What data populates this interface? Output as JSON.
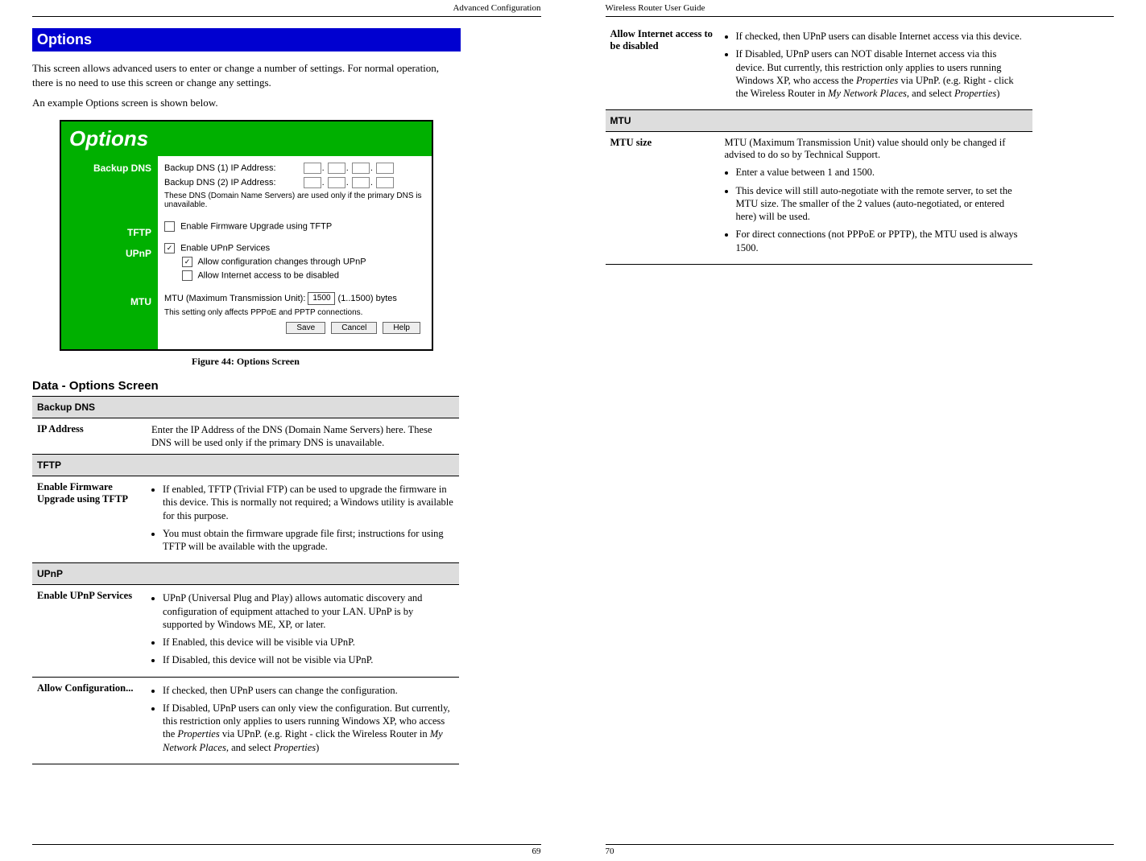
{
  "left": {
    "header": "Advanced Configuration",
    "section_title": "Options",
    "para1": "This screen allows advanced users to enter or change a number of settings. For normal operation, there is no need to use this screen or change any settings.",
    "para2": "An example Options screen is shown below.",
    "fig_caption": "Figure 44: Options Screen",
    "data_heading": "Data - Options Screen",
    "page_num": "69",
    "screenshot": {
      "title": "Options",
      "side": {
        "backup_dns": "Backup DNS",
        "tftp": "TFTP",
        "upnp": "UPnP",
        "mtu": "MTU"
      },
      "dns1_label": "Backup DNS (1) IP Address:",
      "dns2_label": "Backup DNS (2) IP Address:",
      "dns_note": "These DNS (Domain Name Servers) are used only if the primary DNS is unavailable.",
      "tftp_label": "Enable Firmware Upgrade using TFTP",
      "upnp_enable": "Enable UPnP Services",
      "upnp_cfg": "Allow configuration changes through UPnP",
      "upnp_inet": "Allow Internet access to be disabled",
      "mtu_label_pre": "MTU (Maximum Transmission Unit):",
      "mtu_value": "1500",
      "mtu_label_post": "(1..1500) bytes",
      "mtu_note": "This setting only affects PPPoE and PPTP connections.",
      "btn_save": "Save",
      "btn_cancel": "Cancel",
      "btn_help": "Help"
    },
    "table": {
      "cat_backup_dns": "Backup DNS",
      "ip_label": "IP Address",
      "ip_desc": "Enter the IP Address of the DNS (Domain Name Servers) here. These DNS will be used only if the primary DNS is unavailable.",
      "cat_tftp": "TFTP",
      "tftp_label": "Enable Firmware Upgrade using TFTP",
      "tftp_b1": "If enabled, TFTP (Trivial FTP) can be used to upgrade the firmware in this device. This is normally not required; a Windows utility is available for this purpose.",
      "tftp_b2": "You must obtain the firmware upgrade file first; instructions for using TFTP will be available with the upgrade.",
      "cat_upnp": "UPnP",
      "upnp_en_label": "Enable UPnP Services",
      "upnp_en_b1": "UPnP (Universal Plug and Play) allows automatic discovery and configuration of equipment attached to your LAN. UPnP is by supported by Windows ME, XP, or later.",
      "upnp_en_b2": "If Enabled, this device will be visible via UPnP.",
      "upnp_en_b3": "If Disabled, this device will not be visible via UPnP.",
      "upnp_cfg_label": "Allow Configuration...",
      "upnp_cfg_b1": "If checked, then UPnP users can change the configuration.",
      "upnp_cfg_b2_pre": "If Disabled, UPnP users can only view the configuration. But currently, this restriction only applies to users running Windows XP, who access the ",
      "upnp_cfg_b2_it1": "Properties",
      "upnp_cfg_b2_mid": " via UPnP. (e.g. Right - click the Wireless Router in ",
      "upnp_cfg_b2_it2": "My Network Places",
      "upnp_cfg_b2_post": ", and select ",
      "upnp_cfg_b2_it3": "Properties",
      "upnp_cfg_b2_end": ")"
    }
  },
  "right": {
    "header": "Wireless Router User Guide",
    "page_num": "70",
    "table": {
      "inet_label": "Allow Internet access to be disabled",
      "inet_b1": "If checked, then UPnP users can disable Internet access via this device.",
      "inet_b2_pre": "If Disabled, UPnP users can NOT disable Internet access via this device. But currently, this restriction only applies to users running Windows XP, who access the ",
      "inet_b2_it1": "Properties",
      "inet_b2_mid": " via UPnP. (e.g. Right - click the Wireless Router in ",
      "inet_b2_it2": "My Network Places",
      "inet_b2_post": ", and select ",
      "inet_b2_it3": "Properties",
      "inet_b2_end": ")",
      "cat_mtu": "MTU",
      "mtu_label": "MTU size",
      "mtu_top": "MTU (Maximum Transmission Unit) value should only be changed if advised to do so by Technical Support.",
      "mtu_b1": "Enter a value between 1 and 1500.",
      "mtu_b2": "This device will still auto-negotiate with the remote server, to set the MTU size. The smaller of the 2 values (auto-negotiated, or entered here) will be used.",
      "mtu_b3": "For direct connections (not PPPoE or PPTP), the MTU used is always 1500."
    }
  }
}
